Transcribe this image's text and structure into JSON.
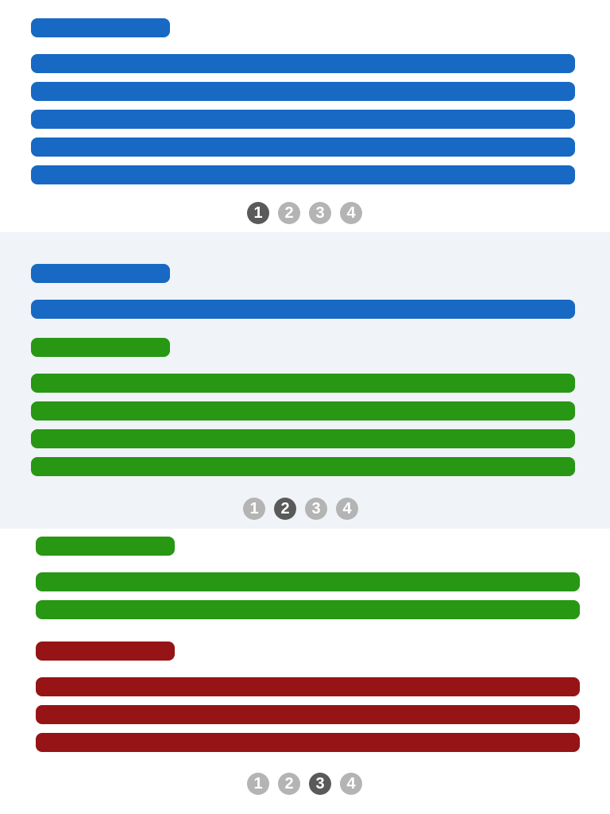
{
  "colors": {
    "blue": "#1769c4",
    "green": "#279714",
    "red": "#961416",
    "dot_active": "#5a5a5a",
    "dot_inactive": "#b4b4b4",
    "section_alt_bg": "#f0f3f7"
  },
  "pagers": [
    {
      "pages": [
        "1",
        "2",
        "3",
        "4"
      ],
      "active": 1
    },
    {
      "pages": [
        "1",
        "2",
        "3",
        "4"
      ],
      "active": 2
    },
    {
      "pages": [
        "1",
        "2",
        "3",
        "4"
      ],
      "active": 3
    }
  ]
}
